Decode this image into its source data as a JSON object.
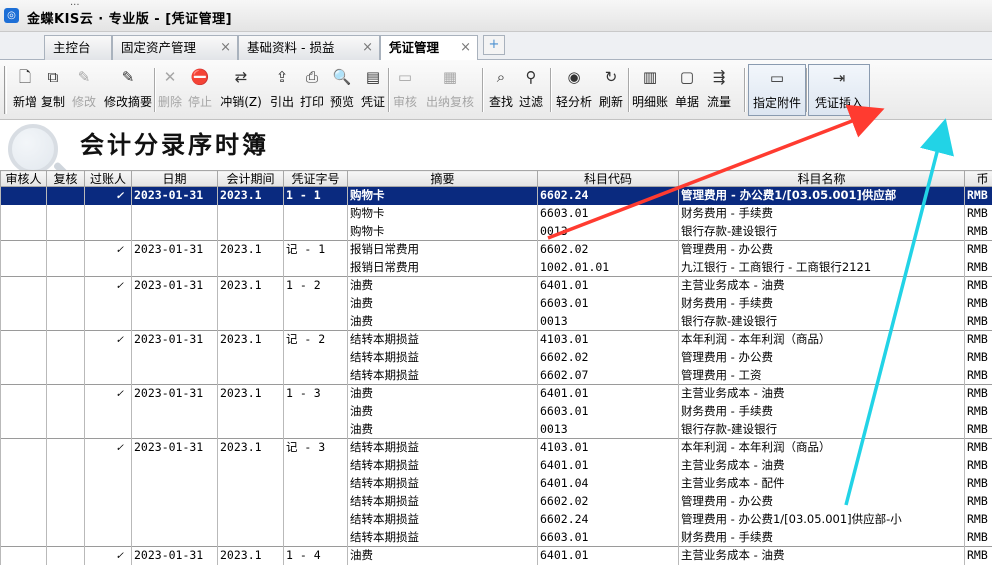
{
  "app": {
    "title": "金蝶KIS云 · 专业版 - [凭证管理]",
    "title_tail": "..."
  },
  "tabs": [
    {
      "label": "主控台",
      "closable": false
    },
    {
      "label": "固定资产管理",
      "closable": true
    },
    {
      "label": "基础资料 - 损益",
      "closable": true
    },
    {
      "label": "凭证管理",
      "closable": true,
      "active": true
    }
  ],
  "tab_add_label": "+",
  "toolbar": [
    {
      "label": "新增",
      "icon": "new-doc-icon",
      "glyph": "🗋",
      "enabled": true
    },
    {
      "label": "复制",
      "icon": "copy-icon",
      "glyph": "⧉",
      "enabled": true
    },
    {
      "label": "修改",
      "icon": "edit-icon",
      "glyph": "✎",
      "enabled": false
    },
    {
      "label": "修改摘要",
      "icon": "edit-summary-icon",
      "glyph": "✎",
      "enabled": true
    },
    {
      "label": "删除",
      "icon": "delete-icon",
      "glyph": "✕",
      "enabled": false
    },
    {
      "label": "停止",
      "icon": "stop-icon",
      "glyph": "⛔",
      "enabled": false
    },
    {
      "label": "冲销(Z)",
      "icon": "reverse-icon",
      "glyph": "⇄",
      "enabled": true
    },
    {
      "label": "引出",
      "icon": "export-icon",
      "glyph": "⇪",
      "enabled": true
    },
    {
      "label": "打印",
      "icon": "print-icon",
      "glyph": "⎙",
      "enabled": true
    },
    {
      "label": "预览",
      "icon": "preview-icon",
      "glyph": "🔍",
      "enabled": true
    },
    {
      "label": "凭证",
      "icon": "voucher-icon",
      "glyph": "▤",
      "enabled": true
    },
    {
      "label": "审核",
      "icon": "audit-icon",
      "glyph": "▭",
      "enabled": false
    },
    {
      "label": "出纳复核",
      "icon": "cashier-review-icon",
      "glyph": "▦",
      "enabled": false
    },
    {
      "label": "查找",
      "icon": "find-icon",
      "glyph": "⌕",
      "enabled": true
    },
    {
      "label": "过滤",
      "icon": "filter-icon",
      "glyph": "⚲",
      "enabled": true
    },
    {
      "label": "轻分析",
      "icon": "analysis-icon",
      "glyph": "◉",
      "enabled": true
    },
    {
      "label": "刷新",
      "icon": "refresh-icon",
      "glyph": "↻",
      "enabled": true
    },
    {
      "label": "明细账",
      "icon": "ledger-icon",
      "glyph": "▥",
      "enabled": true
    },
    {
      "label": "单据",
      "icon": "document-icon",
      "glyph": "▢",
      "enabled": true
    },
    {
      "label": "流量",
      "icon": "flow-icon",
      "glyph": "⇶",
      "enabled": true
    },
    {
      "label": "指定附件",
      "icon": "attachment-icon",
      "glyph": "▭",
      "enabled": true
    },
    {
      "label": "凭证插入",
      "icon": "insert-voucher-icon",
      "glyph": "⇥",
      "enabled": true
    }
  ],
  "page_title": "会计分录序时簿",
  "table": {
    "columns": [
      "审核人",
      "复核",
      "过账人",
      "日期",
      "会计期间",
      "凭证字号",
      "摘要",
      "科目代码",
      "科目名称",
      "币"
    ],
    "rows": [
      {
        "posted": "✓",
        "date": "2023-01-31",
        "period": "2023.1",
        "voucher": "1 - 1",
        "summary": "购物卡",
        "code": "6602.24",
        "name": "管理费用 - 办公费1/[03.05.001]供应部",
        "currency": "RMB",
        "first": true,
        "selected": true
      },
      {
        "summary": "购物卡",
        "code": "6603.01",
        "name": "财务费用 - 手续费",
        "currency": "RMB"
      },
      {
        "summary": "购物卡",
        "code": "0013",
        "name": "银行存款-建设银行",
        "currency": "RMB"
      },
      {
        "posted": "✓",
        "date": "2023-01-31",
        "period": "2023.1",
        "voucher": "记 - 1",
        "summary": "报销日常费用",
        "code": "6602.02",
        "name": "管理费用 - 办公费",
        "currency": "RMB",
        "first": true
      },
      {
        "summary": "报销日常费用",
        "code": "1002.01.01",
        "name": "九江银行 - 工商银行 - 工商银行2121",
        "currency": "RMB"
      },
      {
        "posted": "✓",
        "date": "2023-01-31",
        "period": "2023.1",
        "voucher": "1 - 2",
        "summary": "油费",
        "code": "6401.01",
        "name": "主营业务成本 - 油费",
        "currency": "RMB",
        "first": true
      },
      {
        "summary": "油费",
        "code": "6603.01",
        "name": "财务费用 - 手续费",
        "currency": "RMB"
      },
      {
        "summary": "油费",
        "code": "0013",
        "name": "银行存款-建设银行",
        "currency": "RMB"
      },
      {
        "posted": "✓",
        "date": "2023-01-31",
        "period": "2023.1",
        "voucher": "记 - 2",
        "summary": "结转本期损益",
        "code": "4103.01",
        "name": "本年利润 - 本年利润（商品）",
        "currency": "RMB",
        "first": true
      },
      {
        "summary": "结转本期损益",
        "code": "6602.02",
        "name": "管理费用 - 办公费",
        "currency": "RMB"
      },
      {
        "summary": "结转本期损益",
        "code": "6602.07",
        "name": "管理费用 - 工资",
        "currency": "RMB"
      },
      {
        "posted": "✓",
        "date": "2023-01-31",
        "period": "2023.1",
        "voucher": "1 - 3",
        "summary": "油费",
        "code": "6401.01",
        "name": "主营业务成本 - 油费",
        "currency": "RMB",
        "first": true
      },
      {
        "summary": "油费",
        "code": "6603.01",
        "name": "财务费用 - 手续费",
        "currency": "RMB"
      },
      {
        "summary": "油费",
        "code": "0013",
        "name": "银行存款-建设银行",
        "currency": "RMB"
      },
      {
        "posted": "✓",
        "date": "2023-01-31",
        "period": "2023.1",
        "voucher": "记 - 3",
        "summary": "结转本期损益",
        "code": "4103.01",
        "name": "本年利润 - 本年利润（商品）",
        "currency": "RMB",
        "first": true
      },
      {
        "summary": "结转本期损益",
        "code": "6401.01",
        "name": "主营业务成本 - 油费",
        "currency": "RMB"
      },
      {
        "summary": "结转本期损益",
        "code": "6401.04",
        "name": "主营业务成本 - 配件",
        "currency": "RMB"
      },
      {
        "summary": "结转本期损益",
        "code": "6602.02",
        "name": "管理费用 - 办公费",
        "currency": "RMB"
      },
      {
        "summary": "结转本期损益",
        "code": "6602.24",
        "name": "管理费用 - 办公费1/[03.05.001]供应部-小",
        "currency": "RMB"
      },
      {
        "summary": "结转本期损益",
        "code": "6603.01",
        "name": "财务费用 - 手续费",
        "currency": "RMB"
      },
      {
        "posted": "✓",
        "date": "2023-01-31",
        "period": "2023.1",
        "voucher": "1 - 4",
        "summary": "油费",
        "code": "6401.01",
        "name": "主营业务成本 - 油费",
        "currency": "RMB",
        "first": true
      }
    ]
  },
  "annotation_colors": {
    "red_arrow": "#ff3b30",
    "cyan_arrow": "#22d3e6"
  }
}
